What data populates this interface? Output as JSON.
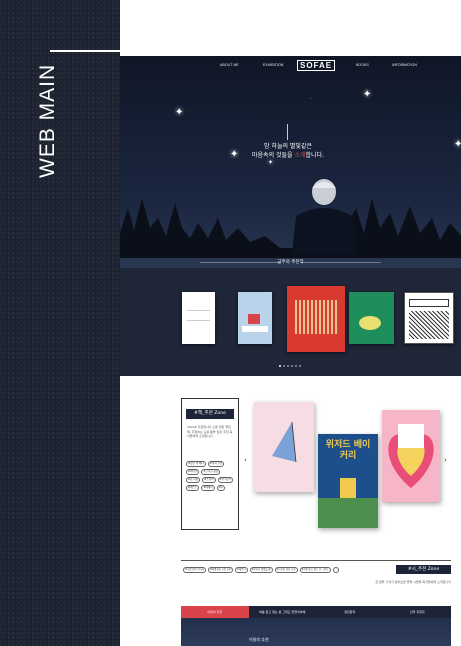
{
  "panel": {
    "vertical_title": "WEB MAIN"
  },
  "nav": {
    "items": [
      "ABOUT ME",
      "EXHIBITION",
      "BOOKS",
      "INFORMATION"
    ],
    "logo": "SOFAE"
  },
  "hero": {
    "line1": "밤 하늘의 별빛같은",
    "line2_pre": "마음속의 것들을 ",
    "line2_em": "소개",
    "line2_post": "합니다.",
    "section_title": "금주의 추천작"
  },
  "recommend": {
    "zone_title": "#책_추천 Zone",
    "zone_desc": "SOFAE 추천합니다 오랜 읽은 좋은 책, 주정하는 도를 통을 담은 추천 독자들에게 소개합니다"
  },
  "poem": {
    "zone_title": "#시_추천 Zone",
    "desc": "한 편을 가져가 입어보면 좋을 시들을 독자들에게 소개합니다"
  },
  "tabs": [
    "이달의 추천",
    "처음 읽고 읽는 본 그려도 맞았어야해",
    "청년창작",
    "인국 추천자"
  ],
  "bottom": {
    "label": "이달의 추천"
  },
  "colors": {
    "dark": "#1e2437",
    "accent": "#d9434a"
  }
}
